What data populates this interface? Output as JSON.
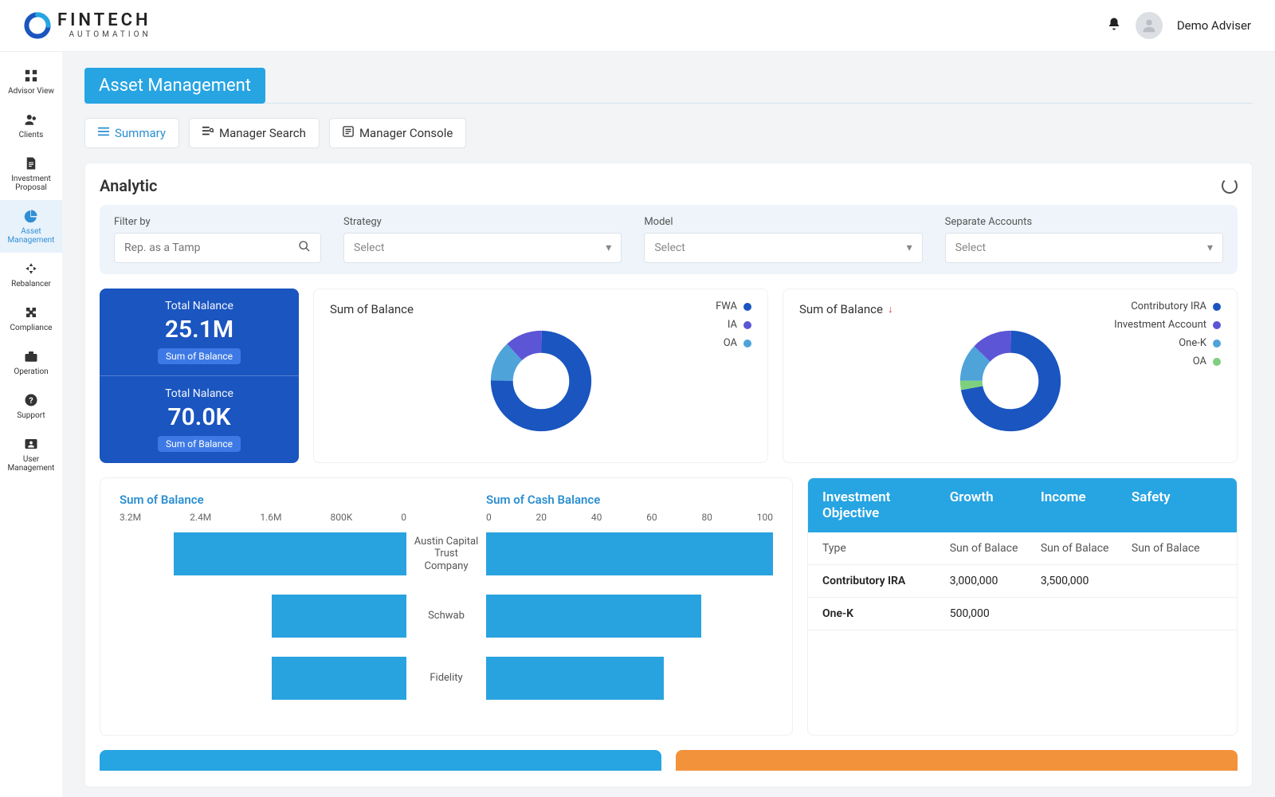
{
  "brand": {
    "name": "FINTECH",
    "tagline": "AUTOMATION"
  },
  "user": {
    "name": "Demo Adviser"
  },
  "sidebar": {
    "items": [
      {
        "label": "Advisor View"
      },
      {
        "label": "Clients"
      },
      {
        "label": "Investment Proposal"
      },
      {
        "label": "Asset Management"
      },
      {
        "label": "Rebalancer"
      },
      {
        "label": "Compliance"
      },
      {
        "label": "Operation"
      },
      {
        "label": "Support"
      },
      {
        "label": "User Management"
      }
    ],
    "activeIndex": 3
  },
  "page": {
    "title": "Asset Management"
  },
  "tabs": [
    {
      "label": "Summary",
      "active": true
    },
    {
      "label": "Manager Search",
      "active": false
    },
    {
      "label": "Manager Console",
      "active": false
    }
  ],
  "panel": {
    "title": "Analytic"
  },
  "filters": {
    "filterBy": {
      "label": "Filter by",
      "placeholder": "Rep. as a Tamp"
    },
    "strategy": {
      "label": "Strategy",
      "placeholder": "Select"
    },
    "model": {
      "label": "Model",
      "placeholder": "Select"
    },
    "separate": {
      "label": "Separate Accounts",
      "placeholder": "Select"
    }
  },
  "totals": [
    {
      "label": "Total Nalance",
      "value": "25.1M",
      "badge": "Sum of Balance"
    },
    {
      "label": "Total Nalance",
      "value": "70.0K",
      "badge": "Sum of Balance"
    }
  ],
  "donut1": {
    "title": "Sum of Balance",
    "legend": [
      {
        "label": "FWA",
        "color": "#1a55c0"
      },
      {
        "label": "IA",
        "color": "#5c55d6"
      },
      {
        "label": "OA",
        "color": "#4ea3d9"
      }
    ]
  },
  "donut2": {
    "title": "Sum of Balance",
    "trendDown": true,
    "legend": [
      {
        "label": "Contributory IRA",
        "color": "#1a55c0"
      },
      {
        "label": "Investment Account",
        "color": "#5c55d6"
      },
      {
        "label": "One-K",
        "color": "#4ea3d9"
      },
      {
        "label": "OA",
        "color": "#7ed07e"
      }
    ]
  },
  "dualBar": {
    "leftTitle": "Sum of Balance",
    "rightTitle": "Sum of Cash Balance",
    "leftTicks": [
      "3.2M",
      "2.4M",
      "1.6M",
      "800K",
      "0"
    ],
    "rightTicks": [
      "0",
      "20",
      "40",
      "60",
      "80",
      "100"
    ],
    "rows": [
      {
        "label": "Austin Capital Trust Company"
      },
      {
        "label": "Schwab"
      },
      {
        "label": "Fidelity"
      }
    ]
  },
  "objTable": {
    "headers": [
      "Investment Objective",
      "Growth",
      "Income",
      "Safety"
    ],
    "subHeaders": [
      "Type",
      "Sun of Balace",
      "Sun of Balace",
      "Sun of Balace"
    ],
    "rows": [
      [
        "Contributory IRA",
        "3,000,000",
        "3,500,000",
        ""
      ],
      [
        "One-K",
        "500,000",
        "",
        ""
      ]
    ]
  },
  "chart_data": [
    {
      "type": "pie",
      "title": "Sum of Balance",
      "series": [
        {
          "name": "FWA",
          "value": 75,
          "color": "#1a55c0"
        },
        {
          "name": "IA",
          "value": 12,
          "color": "#5c55d6"
        },
        {
          "name": "OA",
          "value": 13,
          "color": "#4ea3d9"
        }
      ]
    },
    {
      "type": "pie",
      "title": "Sum of Balance",
      "series": [
        {
          "name": "Contributory IRA",
          "value": 72,
          "color": "#1a55c0"
        },
        {
          "name": "Investment Account",
          "value": 13,
          "color": "#5c55d6"
        },
        {
          "name": "One-K",
          "value": 12,
          "color": "#4ea3d9"
        },
        {
          "name": "OA",
          "value": 3,
          "color": "#7ed07e"
        }
      ]
    },
    {
      "type": "bar",
      "title": "Sum of Balance",
      "orientation": "horizontal-reversed",
      "xlabel": "",
      "ylabel": "",
      "xlim": [
        0,
        3200000
      ],
      "ticks": [
        "3.2M",
        "2.4M",
        "1.6M",
        "800K",
        "0"
      ],
      "categories": [
        "Austin Capital Trust Company",
        "Schwab",
        "Fidelity"
      ],
      "values": [
        2600000,
        1500000,
        1500000
      ]
    },
    {
      "type": "bar",
      "title": "Sum of Cash Balance",
      "orientation": "horizontal",
      "xlabel": "",
      "ylabel": "",
      "xlim": [
        0,
        100
      ],
      "ticks": [
        "0",
        "20",
        "40",
        "60",
        "80",
        "100"
      ],
      "categories": [
        "Austin Capital Trust Company",
        "Schwab",
        "Fidelity"
      ],
      "values": [
        100,
        75,
        62
      ]
    }
  ]
}
